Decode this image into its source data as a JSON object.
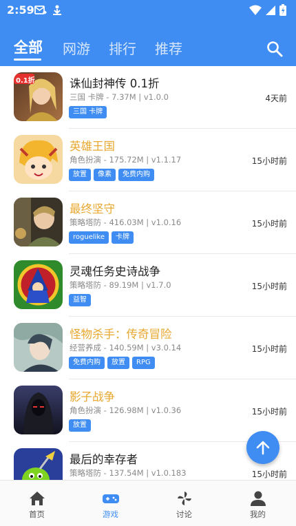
{
  "status": {
    "time": "2:59"
  },
  "tabs": [
    {
      "label": "全部",
      "active": true
    },
    {
      "label": "网游"
    },
    {
      "label": "排行"
    },
    {
      "label": "推荐"
    }
  ],
  "games": [
    {
      "title": "诛仙封神传 0.1折",
      "meta": "三国 卡牌 - 7.37M | v1.0.0",
      "tags": [
        "三国 卡牌"
      ],
      "time": "4天前",
      "gold": false,
      "badge": "0.1折",
      "icon": "warrior-woman-icon"
    },
    {
      "title": "英雄王国",
      "meta": "角色扮演 - 175.72M | v1.1.17",
      "tags": [
        "放置",
        "像素",
        "免费内购"
      ],
      "time": "15小时前",
      "gold": true,
      "icon": "cartoon-hero-icon"
    },
    {
      "title": "最终坚守",
      "meta": "策略塔防 - 416.03M | v1.0.16",
      "tags": [
        "roguelike",
        "卡牌"
      ],
      "time": "15小时前",
      "gold": true,
      "icon": "soldier-icon"
    },
    {
      "title": "灵魂任务史诗战争",
      "meta": "策略塔防 - 89.19M | v1.7.0",
      "tags": [
        "益智"
      ],
      "time": "15小时前",
      "gold": false,
      "icon": "wizard-icon"
    },
    {
      "title": "怪物杀手：传奇冒险",
      "meta": "经营养成 - 140.59M | v3.0.14",
      "tags": [
        "免费内购",
        "放置",
        "RPG"
      ],
      "time": "15小时前",
      "gold": true,
      "icon": "anime-character-icon"
    },
    {
      "title": "影子战争",
      "meta": "角色扮演 - 126.98M | v1.0.36",
      "tags": [
        "放置"
      ],
      "time": "15小时前",
      "gold": true,
      "icon": "hooded-figure-icon"
    },
    {
      "title": "最后的幸存者",
      "meta": "策略塔防 - 137.54M | v1.0.183",
      "tags": [
        "",
        ""
      ],
      "time": "15小时前",
      "gold": false,
      "icon": "green-monster-icon"
    }
  ],
  "nav": [
    {
      "label": "首页",
      "icon": "home-icon"
    },
    {
      "label": "游戏",
      "icon": "gamepad-icon",
      "active": true
    },
    {
      "label": "讨论",
      "icon": "pinwheel-icon"
    },
    {
      "label": "我的",
      "icon": "user-icon"
    }
  ],
  "colors": {
    "primary": "#3f8df2",
    "gold_title": "#e8a72e"
  }
}
